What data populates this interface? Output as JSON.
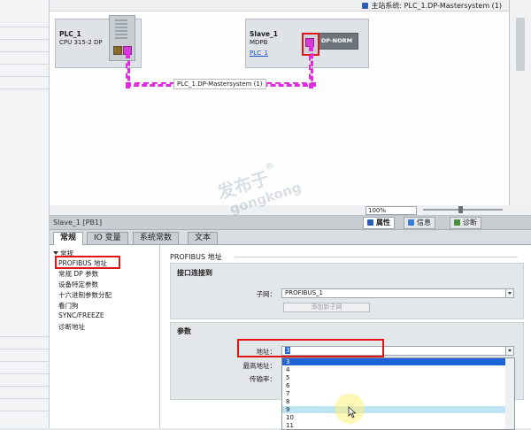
{
  "colors": {
    "bus": "#e02be0",
    "highlight": "#e01515",
    "selection": "#1e64d8",
    "hover": "#bfe3f5",
    "link": "#1a4fc4"
  },
  "network_view": {
    "master_system_label": "主站系统: PLC_1.DP-Mastersystem (1)",
    "plc": {
      "name": "PLC_1",
      "type": "CPU 315-2 DP"
    },
    "slave": {
      "name": "Slave_1",
      "type": "MDPB",
      "link": "PLC_1",
      "module_label": "DP-NORM"
    },
    "bus_label": "PLC_1.DP-Mastersystem (1)",
    "zoom": "100%"
  },
  "inspector": {
    "title": "Slave_1 [PB1]",
    "right_tabs": [
      "属性",
      "信息",
      "诊断"
    ],
    "tabs": [
      "常规",
      "IO 变量",
      "系统常数",
      "文本"
    ],
    "nav": [
      "常规",
      "PROFIBUS 地址",
      "常规 DP 参数",
      "设备特定参数",
      "十六进制参数分配",
      "看门狗",
      "SYNC/FREEZE",
      "诊断地址"
    ],
    "section_title": "PROFIBUS 地址",
    "interface_group": {
      "title": "接口连接到",
      "subnet_label": "子网：",
      "subnet_value": "PROFIBUS_1",
      "add_subnet_button": "添加新子网"
    },
    "params_group": {
      "title": "参数",
      "address_label": "地址：",
      "address_value": "3",
      "highest_address_label": "最高地址：",
      "baud_rate_label": "传输率："
    },
    "address_options": [
      "3",
      "4",
      "5",
      "6",
      "7",
      "8",
      "9",
      "10",
      "11"
    ],
    "selected_option": "3",
    "hovered_option": "9"
  },
  "watermark": {
    "line1": "发布于",
    "line2": "gongkong",
    "mark": "®"
  }
}
